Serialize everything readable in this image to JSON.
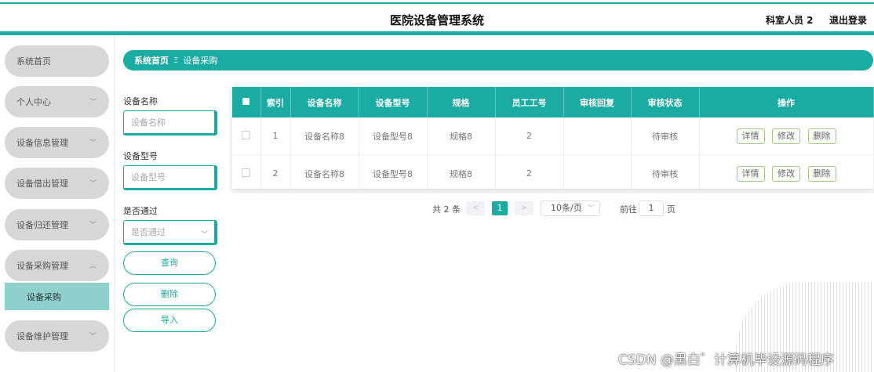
{
  "header": {
    "title": "医院设备管理系统",
    "user": "科室人员 2",
    "logout": "退出登录"
  },
  "sidebar": {
    "items": [
      {
        "label": "系统首页",
        "has_arrow": false
      },
      {
        "label": "个人中心",
        "has_arrow": true
      },
      {
        "label": "设备信息管理",
        "has_arrow": true
      },
      {
        "label": "设备借出管理",
        "has_arrow": true
      },
      {
        "label": "设备归还管理",
        "has_arrow": true
      },
      {
        "label": "设备采购管理",
        "has_arrow": true,
        "expanded": true
      },
      {
        "label": "设备维护管理",
        "has_arrow": true
      }
    ],
    "sub_item": "设备采购"
  },
  "breadcrumb": {
    "home": "系统首页",
    "separator": "Ξ",
    "current": "设备采购"
  },
  "filters": {
    "name_label": "设备名称",
    "name_placeholder": "设备名称",
    "model_label": "设备型号",
    "model_placeholder": "设备型号",
    "pass_label": "是否通过",
    "pass_placeholder": "是否通过",
    "query_btn": "查询",
    "delete_btn": "删除",
    "import_btn": "导入"
  },
  "table": {
    "columns": [
      "索引",
      "设备名称",
      "设备型号",
      "规格",
      "员工工号",
      "审核回复",
      "审核状态",
      "操作"
    ],
    "rows": [
      {
        "index": "1",
        "name": "设备名称8",
        "model": "设备型号8",
        "spec": "规格8",
        "emp_no": "2",
        "reply": "",
        "status": "待审核"
      },
      {
        "index": "2",
        "name": "设备名称8",
        "model": "设备型号8",
        "spec": "规格8",
        "emp_no": "2",
        "reply": "",
        "status": "待审核"
      }
    ],
    "actions": {
      "detail": "详情",
      "edit": "修改",
      "delete": "删除"
    }
  },
  "pagination": {
    "total": "共 2 条",
    "prev": "<",
    "current_page": "1",
    "next": ">",
    "page_size": "10条/页",
    "goto_label": "前往",
    "goto_value": "1",
    "page_unit": "页"
  },
  "watermark": "CSDN @黑白゛计算机毕设源码程序",
  "colors": {
    "accent": "#1aaba3",
    "sub_item_bg": "#8ed1cc",
    "menu_bg": "#d7d7d7"
  }
}
